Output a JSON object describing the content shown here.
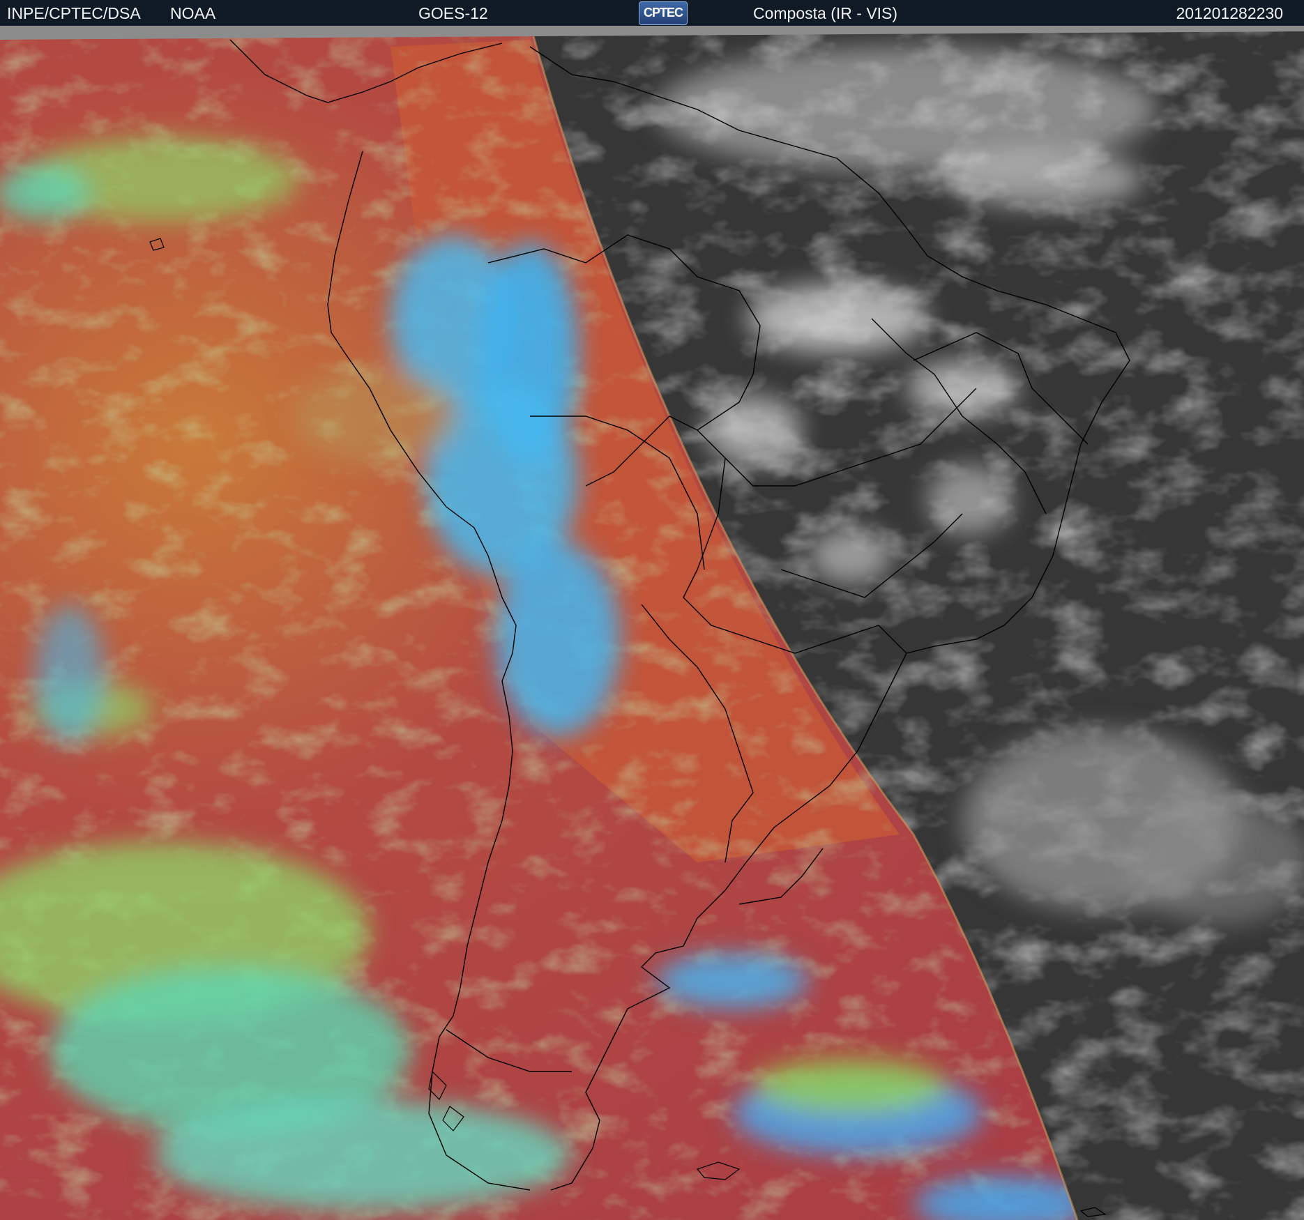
{
  "header": {
    "org": "INPE/CPTEC/DSA",
    "agency": "NOAA",
    "satellite": "GOES-12",
    "logo_text": "CPTEC",
    "product": "Composta (IR - VIS)",
    "timestamp": "201201282230"
  },
  "colors": {
    "header_bg": "#0f1a26",
    "ir_clear_sky": "#b0443f",
    "ir_land": "#c65a3a",
    "ir_cold_cloud": "#46b6f0",
    "ir_mid_cloud": "#8ed86a",
    "vis_background": "#3a3a3a",
    "vis_cloud": "#d9d9d9",
    "coastline": "#000000"
  },
  "map": {
    "satellite_view": "composite infrared (left, false color) and visible (right, grayscale) over South America",
    "day_night_terminator": "curved boundary running from top-center to bottom-right"
  }
}
